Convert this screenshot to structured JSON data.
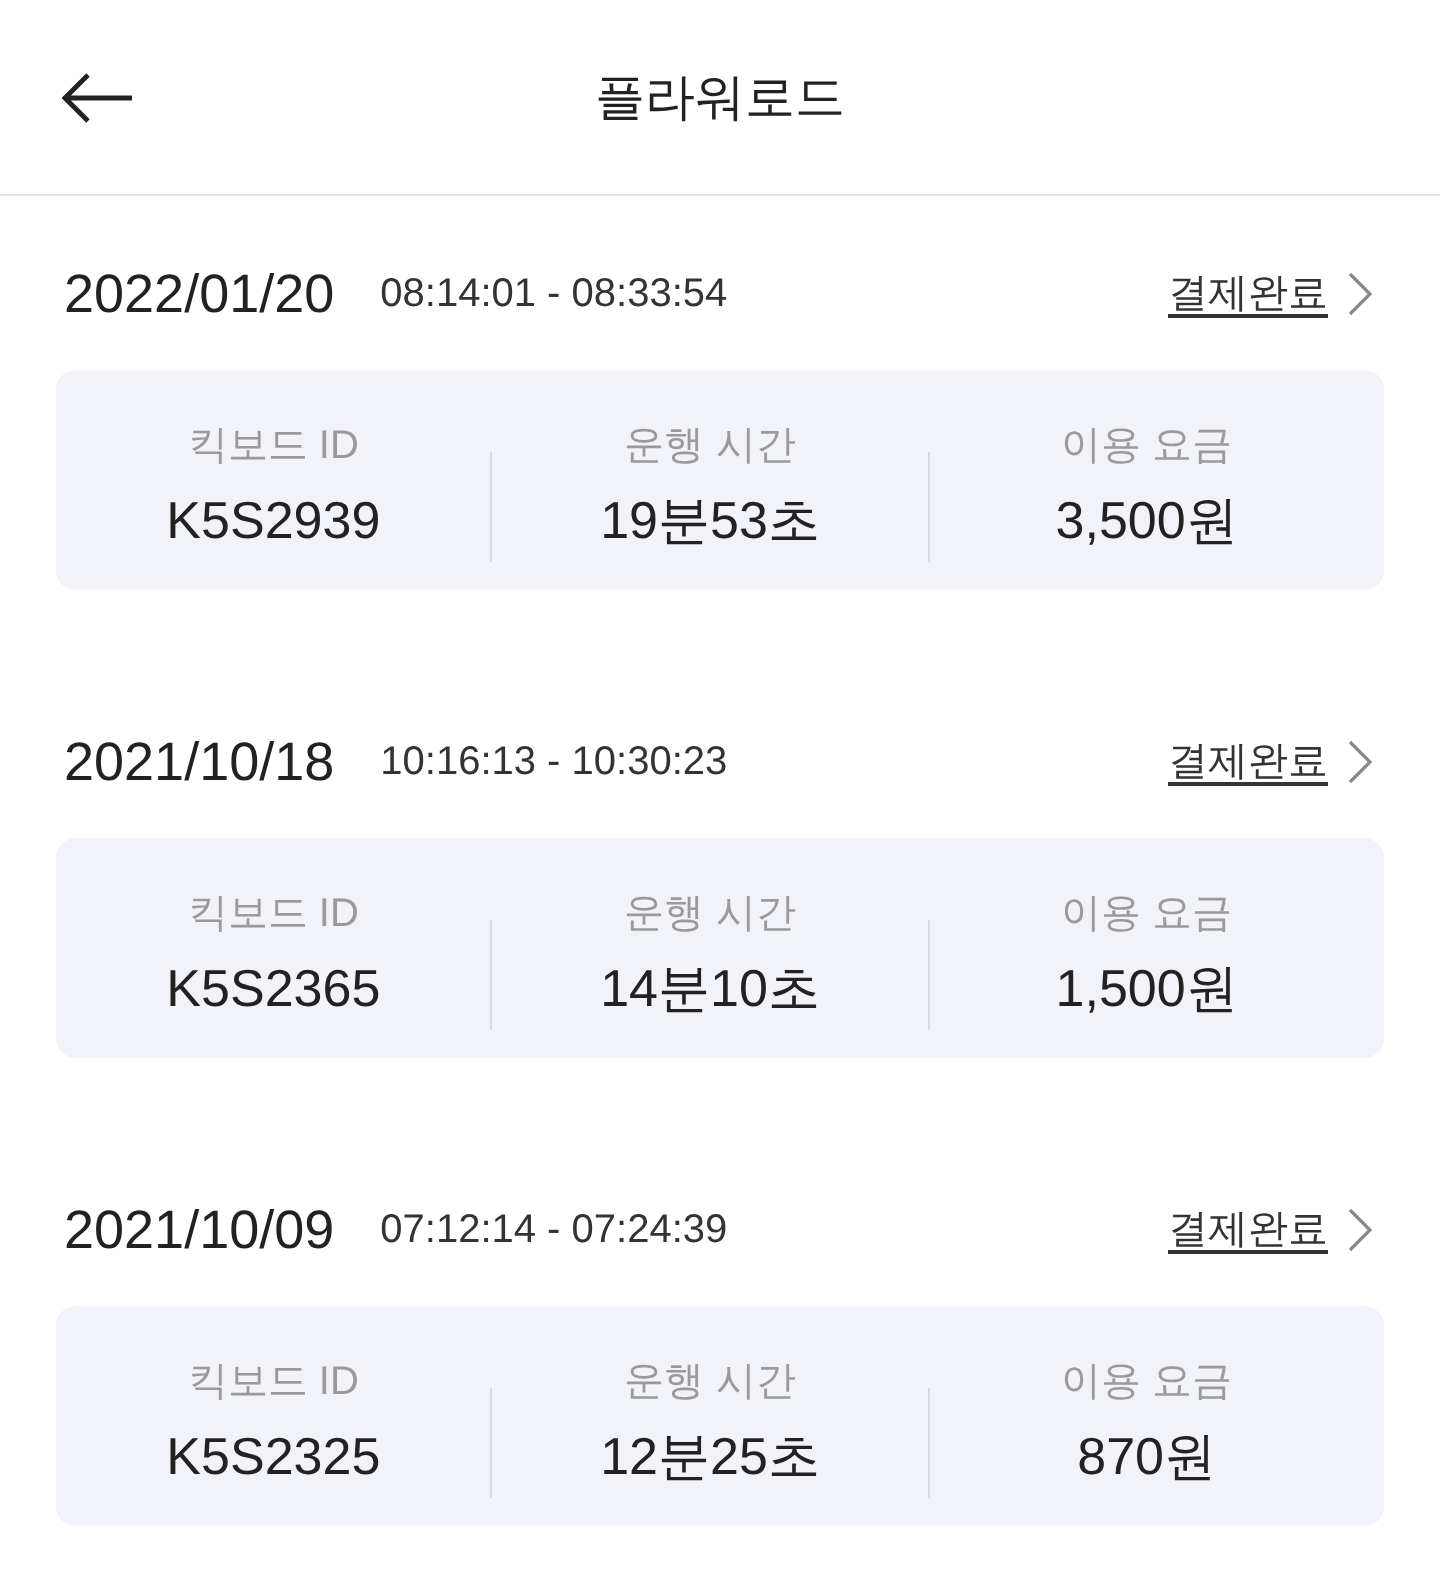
{
  "header": {
    "title": "플라워로드"
  },
  "rides": [
    {
      "date": "2022/01/20",
      "time_range": "08:14:01 - 08:33:54",
      "status": "결제완료",
      "fields": [
        {
          "label": "킥보드 ID",
          "value": "K5S2939"
        },
        {
          "label": "운행 시간",
          "value": "19분53초"
        },
        {
          "label": "이용 요금",
          "value": "3,500원"
        }
      ]
    },
    {
      "date": "2021/10/18",
      "time_range": "10:16:13 - 10:30:23",
      "status": "결제완료",
      "fields": [
        {
          "label": "킥보드 ID",
          "value": "K5S2365"
        },
        {
          "label": "운행 시간",
          "value": "14분10초"
        },
        {
          "label": "이용 요금",
          "value": "1,500원"
        }
      ]
    },
    {
      "date": "2021/10/09",
      "time_range": "07:12:14 - 07:24:39",
      "status": "결제완료",
      "fields": [
        {
          "label": "킥보드 ID",
          "value": "K5S2325"
        },
        {
          "label": "운행 시간",
          "value": "12분25초"
        },
        {
          "label": "이용 요금",
          "value": "870원"
        }
      ]
    }
  ]
}
